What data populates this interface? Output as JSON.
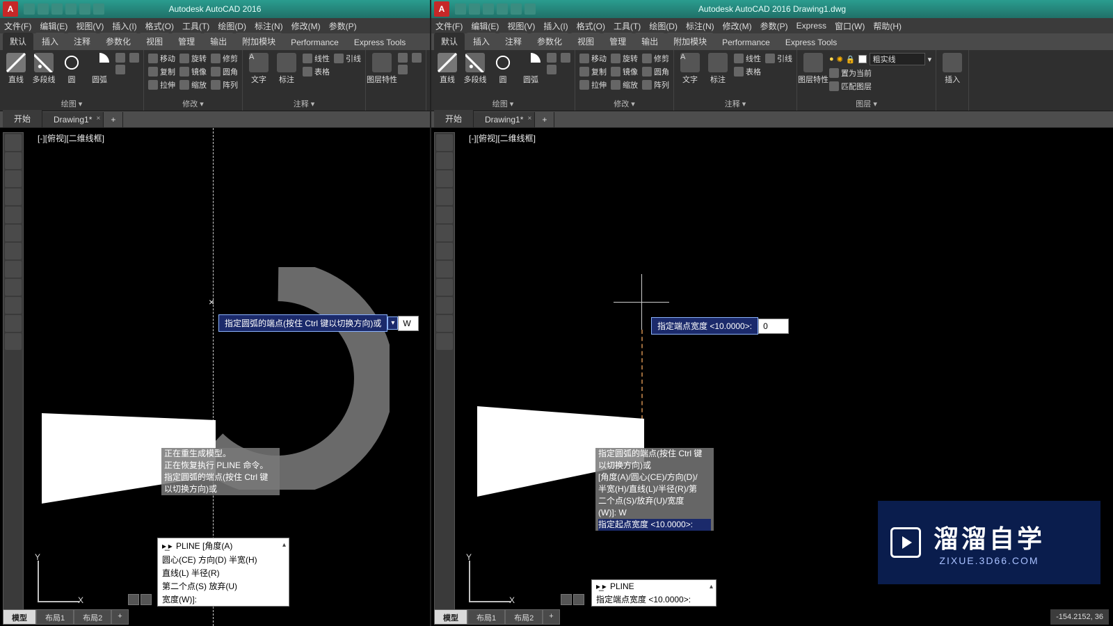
{
  "left": {
    "title": "Autodesk AutoCAD 2016",
    "menus": [
      "文件(F)",
      "编辑(E)",
      "视图(V)",
      "插入(I)",
      "格式(O)",
      "工具(T)",
      "绘图(D)",
      "标注(N)",
      "修改(M)",
      "参数(P)"
    ],
    "ribbon_tabs": [
      "默认",
      "插入",
      "注释",
      "参数化",
      "视图",
      "管理",
      "输出",
      "附加模块",
      "Performance",
      "Express Tools"
    ],
    "active_ribbon_tab": 0,
    "panels": {
      "draw": {
        "title": "绘图 ▾",
        "line": "直线",
        "pline": "多段线",
        "circle": "圆",
        "arc": "圆弧"
      },
      "modify": {
        "title": "修改 ▾",
        "move": "移动",
        "rotate": "旋转",
        "trim": "修剪",
        "copy": "复制",
        "mirror": "镜像",
        "fillet": "圆角",
        "stretch": "拉伸",
        "scale": "缩放",
        "array": "阵列"
      },
      "annot": {
        "title": "注释 ▾",
        "text": "文字",
        "dim": "标注",
        "leader": "引线",
        "linetype": "线性",
        "table": "表格"
      },
      "layer": {
        "title": "图层特性"
      }
    },
    "doc_tabs": {
      "start": "开始",
      "drawing": "Drawing1*"
    },
    "viewport_label": "[-][俯视][二维线框]",
    "side_label": "开始",
    "dyn_prompt": {
      "label": "指定圆弧的端点(按住 Ctrl 键以切换方向)或",
      "input": "W"
    },
    "cmd_history": [
      "正在重生成模型。",
      "正在恢复执行 PLINE 命令。",
      "指定圆弧的端点(按住 Ctrl 键",
      "以切换方向)或"
    ],
    "cmd_popup": {
      "header": "PLINE [角度(A)",
      "lines": [
        "圆心(CE) 方向(D) 半宽(H)",
        "直线(L) 半径(R)",
        "第二个点(S) 放弃(U)",
        "宽度(W)]:"
      ]
    },
    "model_tabs": [
      "模型",
      "布局1",
      "布局2"
    ],
    "axes": {
      "x": "X",
      "y": "Y"
    }
  },
  "right": {
    "title": "Autodesk AutoCAD 2016   Drawing1.dwg",
    "menus": [
      "文件(F)",
      "编辑(E)",
      "视图(V)",
      "插入(I)",
      "格式(O)",
      "工具(T)",
      "绘图(D)",
      "标注(N)",
      "修改(M)",
      "参数(P)",
      "Express",
      "窗口(W)",
      "帮助(H)"
    ],
    "ribbon_tabs": [
      "默认",
      "插入",
      "注释",
      "参数化",
      "视图",
      "管理",
      "输出",
      "附加模块",
      "Performance",
      "Express Tools"
    ],
    "active_ribbon_tab": 0,
    "panels": {
      "draw": {
        "title": "绘图 ▾",
        "line": "直线",
        "pline": "多段线",
        "circle": "圆",
        "arc": "圆弧"
      },
      "modify": {
        "title": "修改 ▾",
        "move": "移动",
        "rotate": "旋转",
        "trim": "修剪",
        "copy": "复制",
        "mirror": "镜像",
        "fillet": "圆角",
        "stretch": "拉伸",
        "scale": "缩放",
        "array": "阵列"
      },
      "annot": {
        "title": "注释 ▾",
        "text": "文字",
        "dim": "标注",
        "leader": "引线",
        "linetype": "线性",
        "table": "表格"
      },
      "layer": {
        "title": "图层 ▾",
        "props": "图层特性",
        "linetype_label": "粗实线",
        "set_current": "置为当前",
        "match": "匹配图层"
      }
    },
    "extra_big_btn": "插入",
    "doc_tabs": {
      "start": "开始",
      "drawing": "Drawing1*"
    },
    "viewport_label": "[-][俯视][二维线框]",
    "side_label": "开始",
    "dyn_prompt": {
      "label": "指定端点宽度 <10.0000>:",
      "input": "0"
    },
    "cmd_history": [
      "指定圆弧的端点(按住 Ctrl 键",
      "以切换方向)或",
      "[角度(A)/圆心(CE)/方向(D)/",
      "半宽(H)/直线(L)/半径(R)/第",
      "二个点(S)/放弃(U)/宽度",
      "(W)]: W",
      "指定起点宽度 <10.0000>:"
    ],
    "cmd_popup": {
      "header": "PLINE",
      "lines": [
        "指定端点宽度 <10.0000>:"
      ]
    },
    "model_tabs": [
      "模型",
      "布局1",
      "布局2"
    ],
    "axes": {
      "x": "X",
      "y": "Y"
    },
    "status_coords": "-154.2152, 36",
    "watermark": {
      "big": "溜溜自学",
      "small": "ZIXUE.3D66.COM"
    }
  }
}
